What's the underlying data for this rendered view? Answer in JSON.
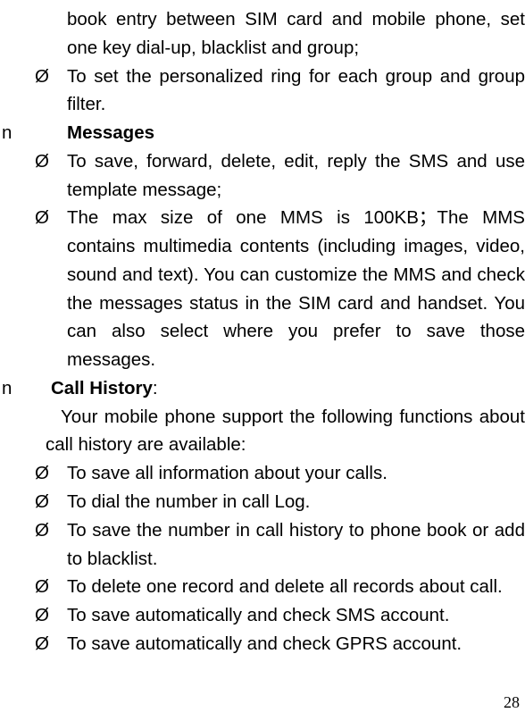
{
  "markers": {
    "section": "n",
    "sub": "Ø"
  },
  "continued_item": "book entry between SIM card and mobile phone, set one key dial-up, blacklist   and group;",
  "pre_section_items": [
    "To set the personalized ring for each group and group filter."
  ],
  "sections": [
    {
      "title": "Messages",
      "items": [
        "To save, forward, delete, edit, reply the SMS and use template message;",
        "The max size of one MMS is 100KB；The MMS contains multimedia contents (including images, video, sound and text). You can customize the MMS and check the messages status in the SIM card and handset.   You can also select where you prefer to save those messages."
      ]
    },
    {
      "title": "Call History",
      "suffix": ":",
      "intro": "Your mobile phone support the following functions about call history are available:",
      "items": [
        "To save all information about your calls.",
        "To dial the number in call Log.",
        "To save the number in call history to phone book or add to blacklist.",
        "To delete one record and delete all records about call.",
        "To save automatically and check SMS account.",
        "To save automatically and check GPRS account."
      ]
    }
  ],
  "page_number": "28"
}
